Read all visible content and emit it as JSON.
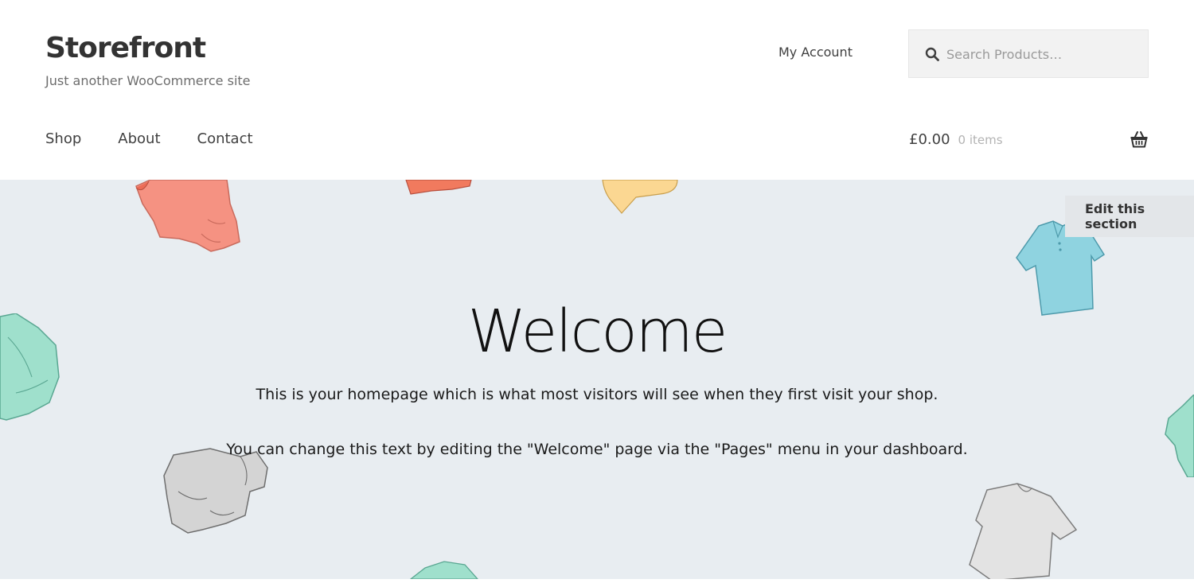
{
  "header": {
    "site_title": "Storefront",
    "tagline": "Just another WooCommerce site",
    "account_link": "My Account",
    "search": {
      "placeholder": "Search Products…"
    },
    "nav": [
      "Shop",
      "About",
      "Contact"
    ],
    "cart": {
      "amount": "£0.00",
      "count": "0 items"
    }
  },
  "hero": {
    "title": "Welcome",
    "paragraph1": "This is your homepage which is what most visitors will see when they first visit your shop.",
    "paragraph2": "You can change this text by editing the \"Welcome\" page via the \"Pages\" menu in your dashboard.",
    "edit_button": "Edit this section",
    "background_color": "#e8edf1"
  },
  "icons": {
    "search": "search-icon",
    "basket": "basket-icon"
  }
}
